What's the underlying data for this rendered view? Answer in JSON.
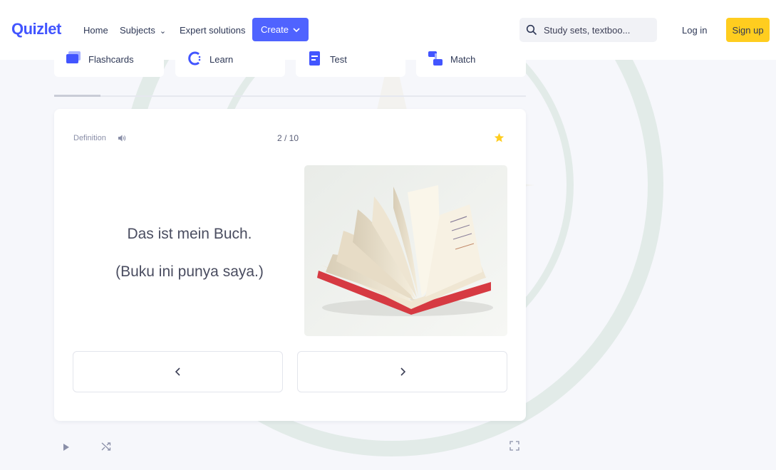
{
  "header": {
    "logo": "Quizlet",
    "nav": {
      "home": "Home",
      "subjects": "Subjects",
      "expert": "Expert solutions"
    },
    "create_label": "Create",
    "search_placeholder": "Study sets, textboo...",
    "login_label": "Log in",
    "signup_label": "Sign up"
  },
  "modes": {
    "flashcards": "Flashcards",
    "learn": "Learn",
    "test": "Test",
    "match": "Match"
  },
  "card": {
    "side_label": "Definition",
    "counter": "2 / 10",
    "line1": "Das ist mein Buch.",
    "line2": "(Buku ini punya saya.)",
    "image": "open-book-image",
    "starred": true
  },
  "icons": {
    "speaker": "speaker-icon",
    "star": "star-icon",
    "prev": "chevron-left-icon",
    "next": "chevron-right-icon",
    "play": "play-icon",
    "shuffle": "shuffle-icon",
    "fullscreen": "fullscreen-icon"
  },
  "colors": {
    "brand": "#4255ff",
    "create_button": "#4f63ff",
    "signup_button": "#ffcd1f",
    "star": "#ffcd1f",
    "background": "#f6f7fb"
  }
}
